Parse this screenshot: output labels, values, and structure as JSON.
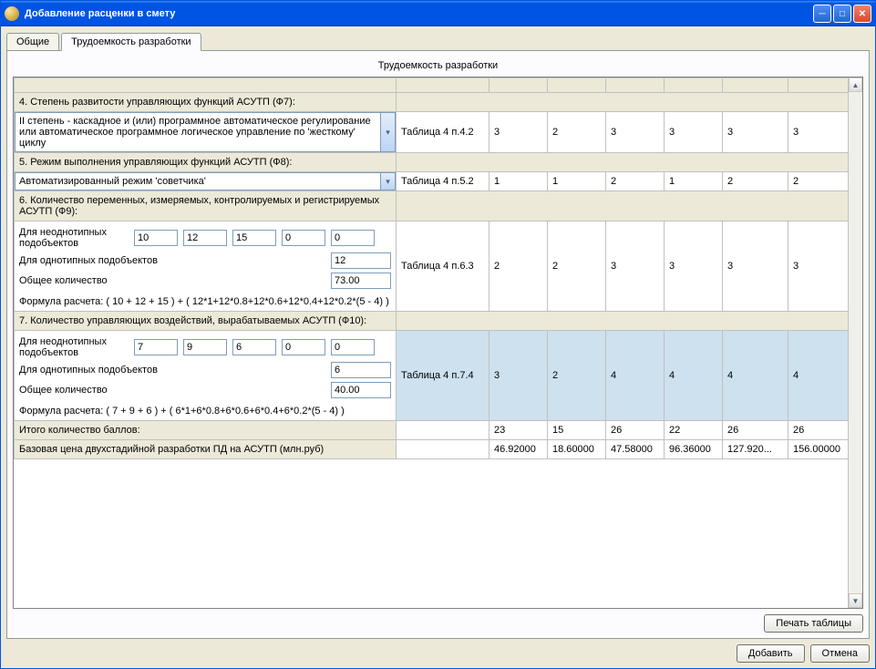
{
  "window": {
    "title": "Добавление расценки в смету"
  },
  "tabs": {
    "general": "Общие",
    "labor": "Трудоемкость разработки"
  },
  "panel_title": "Трудоемкость разработки",
  "rows": {
    "r4": {
      "header": "4. Степень развитости управляющих функций АСУТП (Ф7):",
      "combo": "II степень - каскадное и (или) программное автоматическое регулирование или автоматическое программное логическое управление по 'жесткому' циклу",
      "tabref": "Таблица 4 п.4.2",
      "vals": [
        "3",
        "2",
        "3",
        "3",
        "3",
        "3"
      ]
    },
    "r5": {
      "header": "5. Режим выполнения управляющих функций АСУТП (Ф8):",
      "combo": "Автоматизированный режим 'советчика'",
      "tabref": "Таблица 4 п.5.2",
      "vals": [
        "1",
        "1",
        "2",
        "1",
        "2",
        "2"
      ]
    },
    "r6": {
      "header": "6. Количество переменных, измеряемых, контролируемых и регистрируемых АСУТП (Ф9):",
      "l_hetero": "Для неоднотипных подобъектов",
      "hetero": [
        "10",
        "12",
        "15",
        "0",
        "0"
      ],
      "l_homo": "Для однотипных подобъектов",
      "homo": "12",
      "l_total": "Общее количество",
      "total": "73.00",
      "formula": "Формула расчета: ( 10 + 12 + 15 ) + ( 12*1+12*0.8+12*0.6+12*0.4+12*0.2*(5 - 4) )",
      "tabref": "Таблица 4 п.6.3",
      "vals": [
        "2",
        "2",
        "3",
        "3",
        "3",
        "3"
      ]
    },
    "r7": {
      "header": "7. Количество управляющих воздействий, вырабатываемых АСУТП (Ф10):",
      "l_hetero": "Для неоднотипных подобъектов",
      "hetero": [
        "7",
        "9",
        "6",
        "0",
        "0"
      ],
      "l_homo": "Для однотипных подобъектов",
      "homo": "6",
      "l_total": "Общее количество",
      "total": "40.00",
      "formula": "Формула расчета: ( 7 + 9 + 6 ) + ( 6*1+6*0.8+6*0.6+6*0.4+6*0.2*(5 - 4) )",
      "tabref": "Таблица 4 п.7.4",
      "vals": [
        "3",
        "2",
        "4",
        "4",
        "4",
        "4"
      ]
    },
    "totals": {
      "label": "Итого количество баллов:",
      "vals": [
        "23",
        "15",
        "26",
        "22",
        "26",
        "26"
      ]
    },
    "price": {
      "label": "Базовая цена двухстадийной разработки ПД на АСУТП (млн.руб)",
      "vals": [
        "46.92000",
        "18.60000",
        "47.58000",
        "96.36000",
        "127.920...",
        "156.00000"
      ]
    }
  },
  "buttons": {
    "print": "Печать таблицы",
    "add": "Добавить",
    "cancel": "Отмена"
  }
}
